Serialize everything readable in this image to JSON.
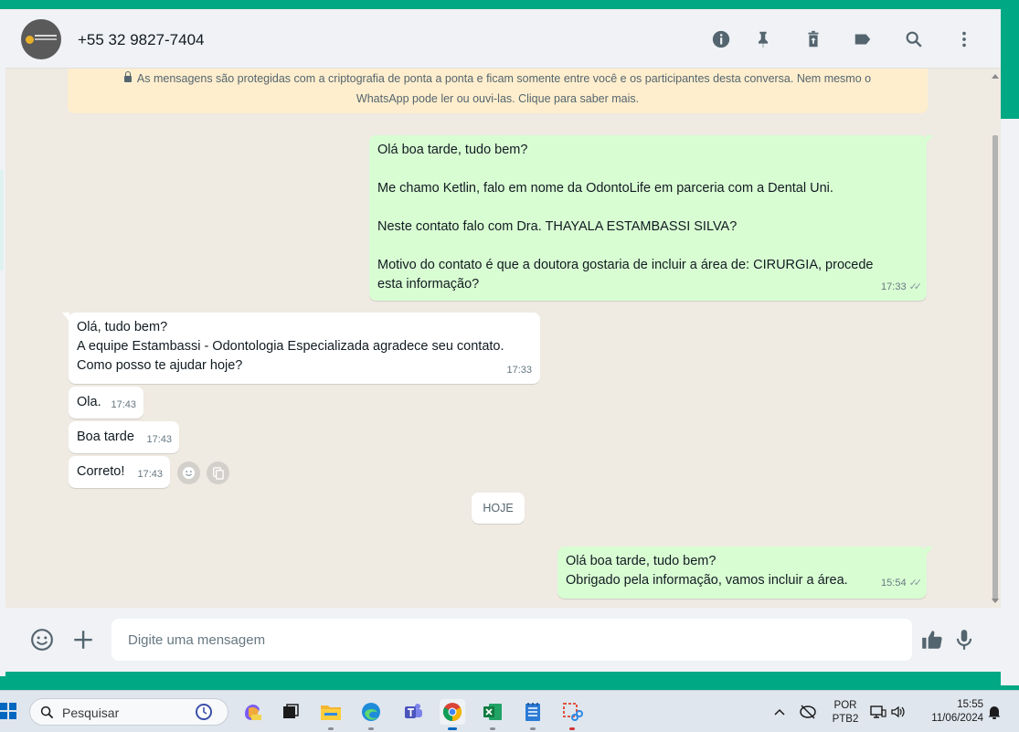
{
  "header": {
    "contact_name": "+55 32 9827-7404",
    "icons": [
      "info-icon",
      "pin-icon",
      "delete-icon",
      "label-icon",
      "search-icon",
      "menu-icon"
    ]
  },
  "encryption_notice": {
    "line1": "As mensagens são protegidas com a criptografia de ponta a ponta e ficam somente entre você e os participantes desta conversa. Nem mesmo o",
    "line2": "WhatsApp pode ler ou ouvi-las. Clique para saber mais."
  },
  "messages": {
    "m1": {
      "p1": "Olá boa tarde, tudo bem?",
      "p2": "Me chamo Ketlin, falo em nome da OdontoLife em parceria com a Dental Uni.",
      "p3": "Neste contato falo com Dra. THAYALA ESTAMBASSI SILVA?",
      "p4a": "Motivo do contato é que a doutora gostaria de incluir a área de: CIRURGIA, procede",
      "p4b": "esta informação?",
      "time": "17:33"
    },
    "m2": {
      "l1": "Olá, tudo bem?",
      "l2": "A equipe Estambassi - Odontologia Especializada agradece seu contato.",
      "l3": "Como posso te ajudar hoje?",
      "time": "17:33"
    },
    "m3": {
      "text": "Ola.",
      "time": "17:43"
    },
    "m4": {
      "text": "Boa tarde",
      "time": "17:43"
    },
    "m5": {
      "text": "Correto!",
      "time": "17:43"
    },
    "date_chip": "HOJE",
    "m6": {
      "l1": "Olá boa tarde, tudo bem?",
      "l2": "Obrigado pela informação, vamos incluir a área.",
      "time": "15:54"
    }
  },
  "composer": {
    "placeholder": "Digite uma mensagem"
  },
  "taskbar": {
    "search_label": "Pesquisar",
    "lang_top": "POR",
    "lang_bottom": "PTB2",
    "time": "15:55",
    "date": "11/06/2024"
  },
  "colors": {
    "accent": "#00a884",
    "outgoing_bubble": "#d9fdd3",
    "incoming_bubble": "#ffffff",
    "notice_bg": "#ffeecd"
  }
}
